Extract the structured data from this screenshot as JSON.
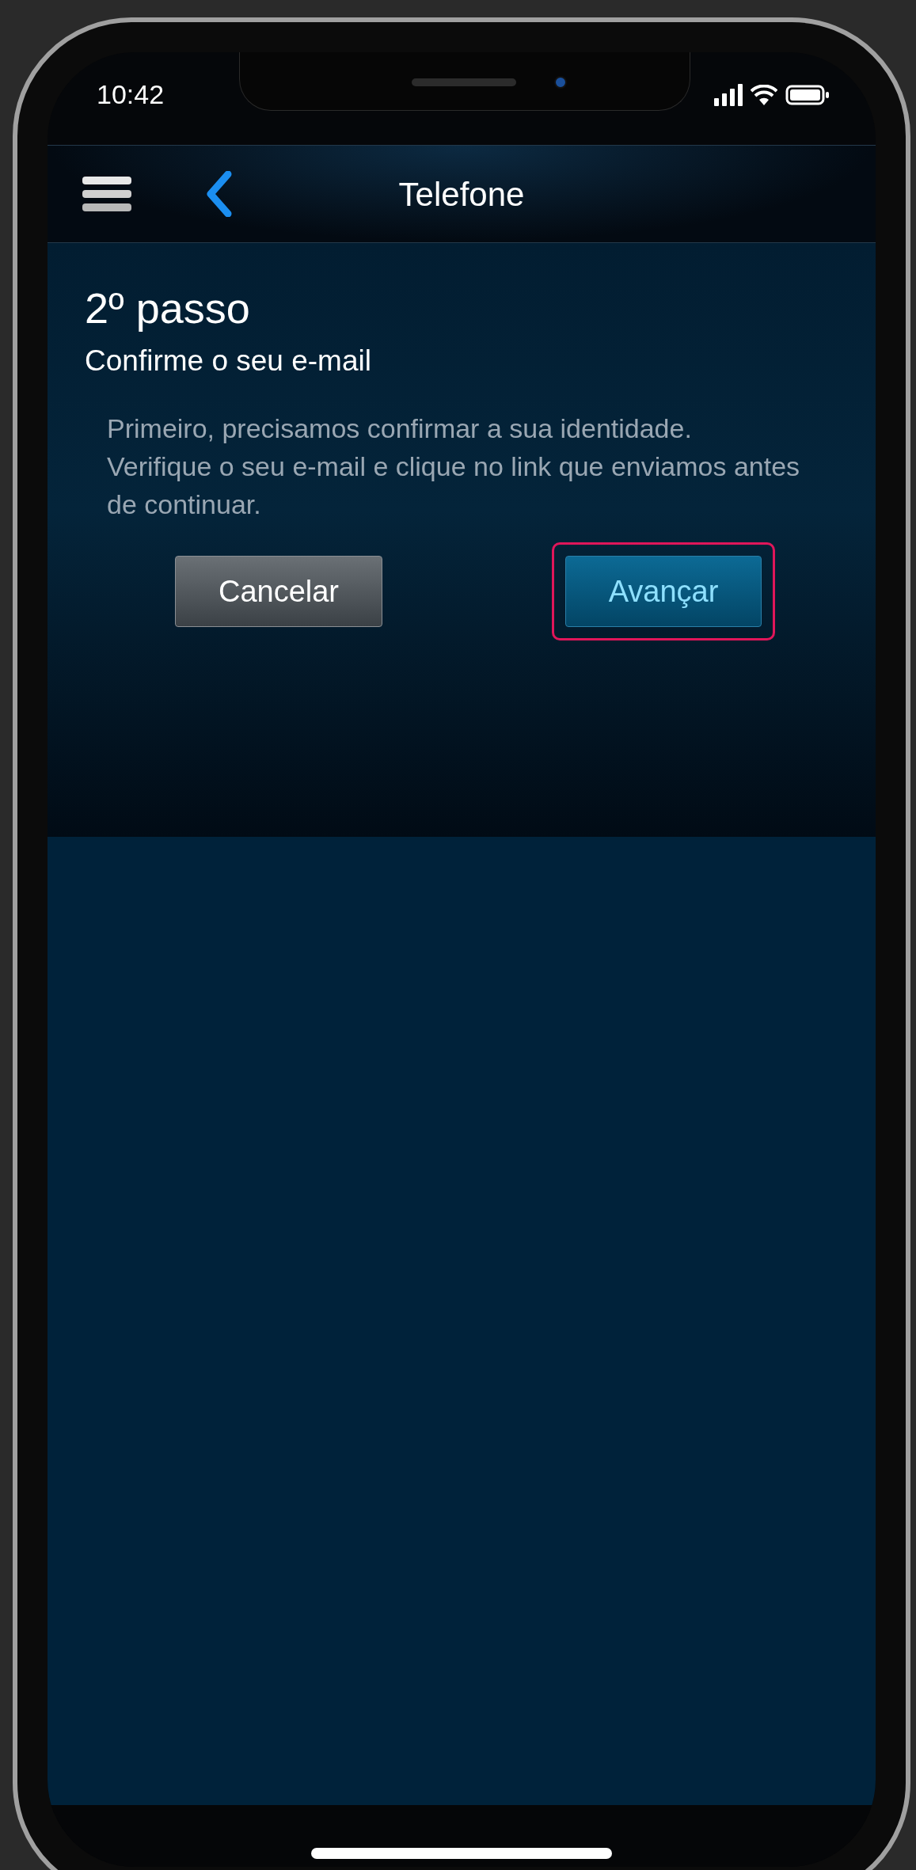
{
  "status_bar": {
    "time": "10:42"
  },
  "nav_bar": {
    "title": "Telefone"
  },
  "step": {
    "title": "2º passo",
    "subtitle": "Confirme o seu e-mail",
    "message": "Primeiro, precisamos confirmar a sua identidade. Verifique o seu e-mail e clique no link que enviamos antes de continuar."
  },
  "buttons": [
    {
      "label": "Cancelar",
      "kind": "secondary",
      "highlighted": false
    },
    {
      "label": "Avançar",
      "kind": "primary",
      "highlighted": true
    }
  ]
}
